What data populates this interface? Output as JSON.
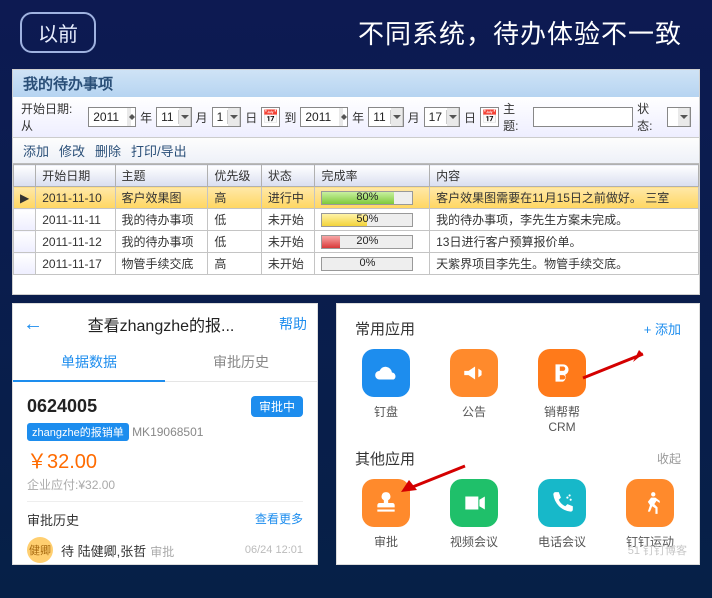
{
  "header": {
    "badge": "以前",
    "title": "不同系统，待办体验不一致"
  },
  "panel1": {
    "title": "我的待办事项",
    "filters": {
      "from_label": "开始日期: 从",
      "from_year": "2011",
      "from_year_suffix": "年",
      "from_month": "11",
      "from_month_suffix": "月",
      "from_day": "1",
      "from_day_suffix": "日",
      "to_label": "到",
      "to_year": "2011",
      "to_year_suffix": "年",
      "to_month": "11",
      "to_month_suffix": "月",
      "to_day": "17",
      "to_day_suffix": "日",
      "subject_label": "主题:",
      "subject_value": "",
      "status_label": "状态:"
    },
    "commands": [
      "添加",
      "修改",
      "删除",
      "打印/导出"
    ],
    "columns": [
      "开始日期",
      "主题",
      "优先级",
      "状态",
      "完成率",
      "内容"
    ],
    "rows": [
      {
        "date": "2011-11-10",
        "subject": "客户效果图",
        "priority": "高",
        "status": "进行中",
        "progress": 80,
        "bar": "green",
        "content": "客户效果图需要在11月15日之前做好。 三室",
        "selected": true
      },
      {
        "date": "2011-11-11",
        "subject": "我的待办事项",
        "priority": "低",
        "status": "未开始",
        "progress": 50,
        "bar": "yel",
        "content": "我的待办事项，李先生方案未完成。"
      },
      {
        "date": "2011-11-12",
        "subject": "我的待办事项",
        "priority": "低",
        "status": "未开始",
        "progress": 20,
        "bar": "red",
        "content": "13日进行客户预算报价单。"
      },
      {
        "date": "2011-11-17",
        "subject": "物管手续交底",
        "priority": "高",
        "status": "未开始",
        "progress": 0,
        "bar": "yel",
        "content": "天紫界项目李先生。物管手续交底。"
      }
    ]
  },
  "panel2": {
    "title_text": "查看zhangzhe的报...",
    "help": "帮助",
    "tabs": {
      "bill": "单据数据",
      "history_tab": "审批历史"
    },
    "doc_no": "0624005",
    "status_pill": "审批中",
    "tag": "zhangzhe的报销单",
    "code": "MK19068501",
    "amount": "￥32.00",
    "company_due_label": "企业应付:",
    "company_due_value": "¥32.00",
    "history_title": "审批历史",
    "more": "查看更多",
    "avatar_text": "健卿",
    "names": "陆健卿,张哲",
    "action": "审批",
    "time": "06/24 12:01"
  },
  "panel3": {
    "freq_title": "常用应用",
    "add": "+ 添加",
    "freq_apps": [
      {
        "name": "钉盘",
        "color": "blue",
        "icon": "cloud"
      },
      {
        "name": "公告",
        "color": "orange",
        "icon": "megaphone"
      },
      {
        "name": "销帮帮CRM",
        "color": "orange2",
        "icon": "b"
      }
    ],
    "other_title": "其他应用",
    "collapse": "收起",
    "other_apps": [
      {
        "name": "审批",
        "color": "orange",
        "icon": "stamp"
      },
      {
        "name": "视频会议",
        "color": "green",
        "icon": "video"
      },
      {
        "name": "电话会议",
        "color": "teal",
        "icon": "phone"
      },
      {
        "name": "钉钉运动",
        "color": "orange",
        "icon": "run"
      }
    ],
    "watermark": "51 钉钉博客"
  }
}
